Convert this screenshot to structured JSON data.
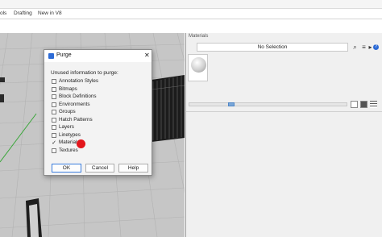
{
  "menubar": {
    "items": [
      "ols",
      "Drafting",
      "New in V8"
    ]
  },
  "materials_panel": {
    "title": "Materials",
    "selection": "No Selection",
    "icons": [
      "search-icon",
      "menu-icon",
      "settings-icon",
      "help-icon"
    ],
    "view_modes": [
      "grid-view-icon",
      "large-view-icon",
      "list-view-icon"
    ]
  },
  "dialog": {
    "title": "Purge",
    "prompt": "Unused information to purge:",
    "options": [
      {
        "label": "Annotation Styles",
        "checked": false
      },
      {
        "label": "Bitmaps",
        "checked": false
      },
      {
        "label": "Block Definitions",
        "checked": false
      },
      {
        "label": "Environments",
        "checked": false
      },
      {
        "label": "Groups",
        "checked": false
      },
      {
        "label": "Hatch Patterns",
        "checked": false
      },
      {
        "label": "Layers",
        "checked": false
      },
      {
        "label": "Linetypes",
        "checked": false
      },
      {
        "label": "Materials",
        "checked": true
      },
      {
        "label": "Textures",
        "checked": false
      }
    ],
    "buttons": {
      "ok": "OK",
      "cancel": "Cancel",
      "help": "Help"
    }
  },
  "colors": {
    "cursor_marker": "#e3151b",
    "accent": "#3b7ddd"
  }
}
